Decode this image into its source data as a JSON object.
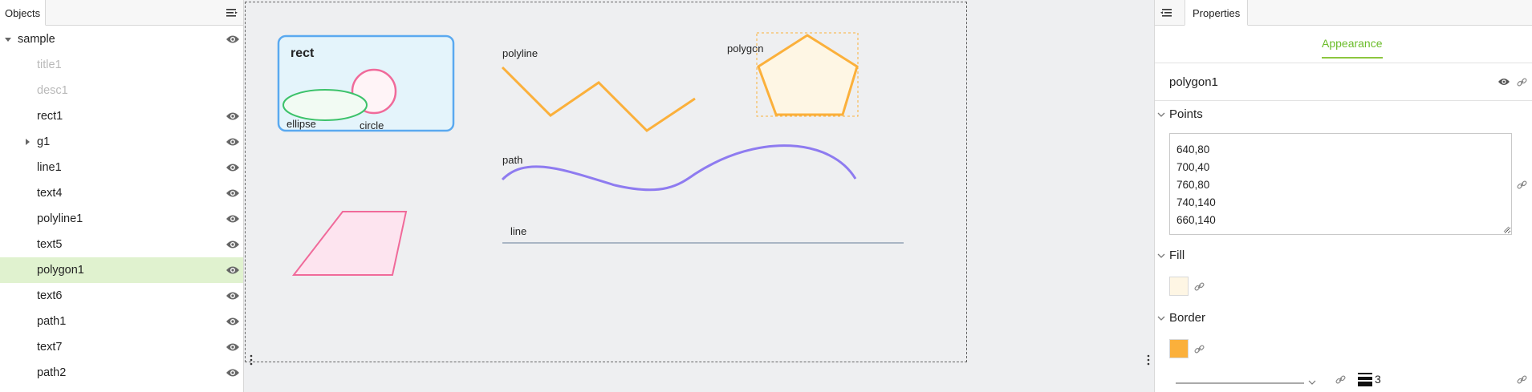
{
  "left_panel": {
    "tab_label": "Objects",
    "tree": [
      {
        "label": "sample",
        "kind": "root",
        "expanded": true,
        "visible_icon": true,
        "faded": false,
        "selected": false
      },
      {
        "label": "title1",
        "kind": "child",
        "visible_icon": false,
        "faded": true,
        "selected": false
      },
      {
        "label": "desc1",
        "kind": "child",
        "visible_icon": false,
        "faded": true,
        "selected": false
      },
      {
        "label": "rect1",
        "kind": "child",
        "visible_icon": true,
        "faded": false,
        "selected": false
      },
      {
        "label": "g1",
        "kind": "group",
        "expanded": false,
        "visible_icon": true,
        "faded": false,
        "selected": false
      },
      {
        "label": "line1",
        "kind": "child",
        "visible_icon": true,
        "faded": false,
        "selected": false
      },
      {
        "label": "text4",
        "kind": "child",
        "visible_icon": true,
        "faded": false,
        "selected": false
      },
      {
        "label": "polyline1",
        "kind": "child",
        "visible_icon": true,
        "faded": false,
        "selected": false
      },
      {
        "label": "text5",
        "kind": "child",
        "visible_icon": true,
        "faded": false,
        "selected": false
      },
      {
        "label": "polygon1",
        "kind": "child",
        "visible_icon": true,
        "faded": false,
        "selected": true
      },
      {
        "label": "text6",
        "kind": "child",
        "visible_icon": true,
        "faded": false,
        "selected": false
      },
      {
        "label": "path1",
        "kind": "child",
        "visible_icon": true,
        "faded": false,
        "selected": false
      },
      {
        "label": "text7",
        "kind": "child",
        "visible_icon": true,
        "faded": false,
        "selected": false
      },
      {
        "label": "path2",
        "kind": "child",
        "visible_icon": true,
        "faded": false,
        "selected": false
      }
    ]
  },
  "canvas": {
    "labels": {
      "rect": "rect",
      "ellipse": "ellipse",
      "circle": "circle",
      "polyline": "polyline",
      "polygon": "polygon",
      "path": "path",
      "line": "line"
    },
    "colors": {
      "rect_stroke": "#5aa9f0",
      "rect_fill": "#e4f4fb",
      "ellipse_stroke": "#3cc26a",
      "ellipse_fill": "#f2fbf3",
      "circle_stroke": "#f06a9a",
      "circle_fill": "#fff4f7",
      "polyline_stroke": "#fbb03b",
      "polygon_stroke": "#fbb03b",
      "polygon_fill": "#fef6e4",
      "path_stroke": "#8e7bf0",
      "parallelogram_stroke": "#f06a9a",
      "parallelogram_fill": "#fde4ef",
      "line_stroke": "#a9b5c4"
    }
  },
  "right_panel": {
    "tab_label": "Properties",
    "appearance_tab": "Appearance",
    "object_name": "polygon1",
    "points_title": "Points",
    "points": [
      "640,80",
      "700,40",
      "760,80",
      "740,140",
      "660,140"
    ],
    "fill_title": "Fill",
    "fill_color": "#fef6e4",
    "border_title": "Border",
    "border_color": "#fbb03b",
    "border_width": "3",
    "accent_color": "#8cc63f"
  }
}
